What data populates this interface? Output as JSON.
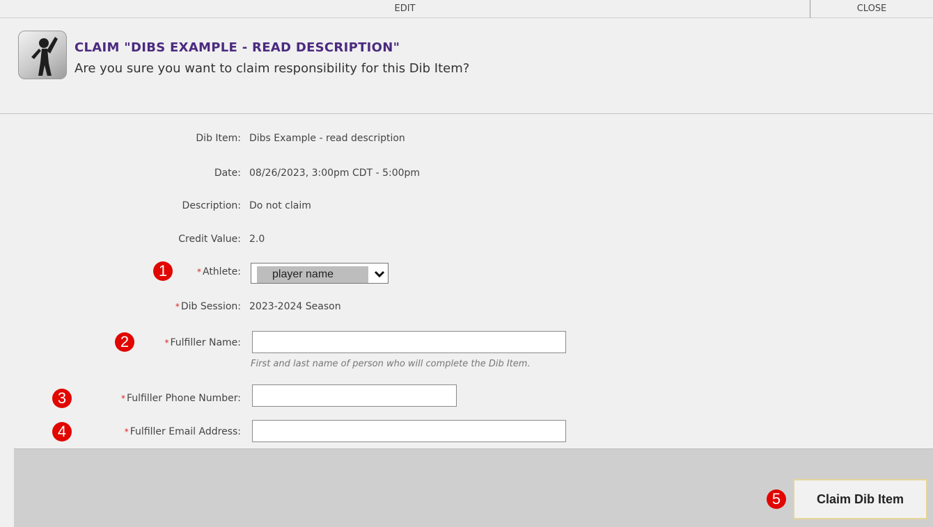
{
  "topbar": {
    "edit": "EDIT",
    "close": "CLOSE"
  },
  "header": {
    "title": "CLAIM \"DIBS EXAMPLE - READ DESCRIPTION\"",
    "subtitle": "Are you sure you want to claim responsibility for this Dib Item?"
  },
  "details": {
    "dib_item": {
      "label": "Dib Item:",
      "value": "Dibs Example - read description"
    },
    "date": {
      "label": "Date:",
      "value": "08/26/2023, 3:00pm CDT - 5:00pm"
    },
    "description": {
      "label": "Description:",
      "value": "Do not claim"
    },
    "credit_value": {
      "label": "Credit Value:",
      "value": "2.0"
    }
  },
  "form": {
    "required_marker": "*",
    "athlete": {
      "label": "Athlete:",
      "selected": "player name"
    },
    "dib_session": {
      "label": "Dib Session:",
      "value": "2023-2024 Season"
    },
    "fulfiller_name": {
      "label": "Fulfiller Name:",
      "value": "",
      "hint": "First and last name of person who will complete the Dib Item."
    },
    "fulfiller_phone": {
      "label": "Fulfiller Phone Number:",
      "value": ""
    },
    "fulfiller_email": {
      "label": "Fulfiller Email Address:",
      "value": ""
    }
  },
  "badges": [
    "1",
    "2",
    "3",
    "4",
    "5"
  ],
  "footer": {
    "claim_button": "Claim Dib Item"
  },
  "colors": {
    "title": "#4b2a7f",
    "badge": "#e10600",
    "required": "#dd2222",
    "footer": "#cfcfcf"
  },
  "icons": {
    "header": "waving-person-icon",
    "select": "chevron-down-icon"
  }
}
